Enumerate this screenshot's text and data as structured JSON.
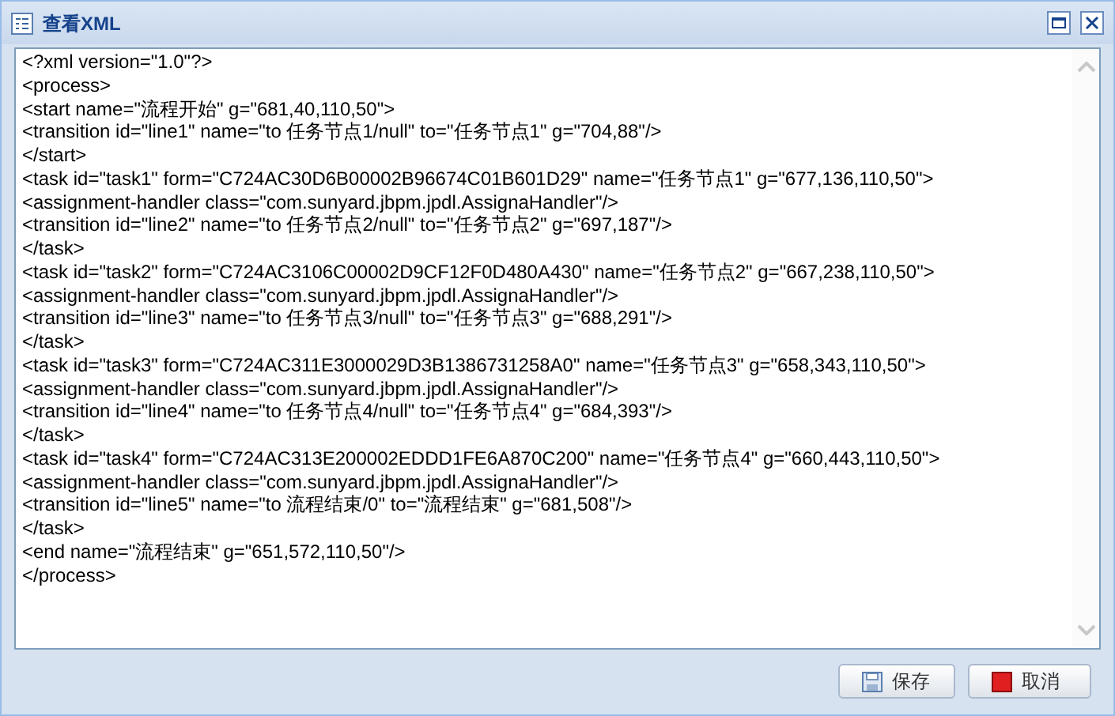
{
  "window": {
    "title": "查看XML"
  },
  "editor": {
    "lines": [
      "<?xml version=\"1.0\"?>",
      "<process>",
      "<start name=\"流程开始\" g=\"681,40,110,50\">",
      "<transition id=\"line1\" name=\"to 任务节点1/null\" to=\"任务节点1\" g=\"704,88\"/>",
      "</start>",
      "<task id=\"task1\" form=\"C724AC30D6B00002B96674C01B601D29\" name=\"任务节点1\" g=\"677,136,110,50\">",
      "<assignment-handler class=\"com.sunyard.jbpm.jpdl.AssignaHandler\"/>",
      "<transition id=\"line2\" name=\"to 任务节点2/null\" to=\"任务节点2\" g=\"697,187\"/>",
      "</task>",
      "<task id=\"task2\" form=\"C724AC3106C00002D9CF12F0D480A430\" name=\"任务节点2\" g=\"667,238,110,50\">",
      "<assignment-handler class=\"com.sunyard.jbpm.jpdl.AssignaHandler\"/>",
      "<transition id=\"line3\" name=\"to 任务节点3/null\" to=\"任务节点3\" g=\"688,291\"/>",
      "</task>",
      "<task id=\"task3\" form=\"C724AC311E3000029D3B1386731258A0\" name=\"任务节点3\" g=\"658,343,110,50\">",
      "<assignment-handler class=\"com.sunyard.jbpm.jpdl.AssignaHandler\"/>",
      "<transition id=\"line4\" name=\"to 任务节点4/null\" to=\"任务节点4\" g=\"684,393\"/>",
      "</task>",
      "<task id=\"task4\" form=\"C724AC313E200002EDDD1FE6A870C200\" name=\"任务节点4\" g=\"660,443,110,50\">",
      "<assignment-handler class=\"com.sunyard.jbpm.jpdl.AssignaHandler\"/>",
      "<transition id=\"line5\" name=\"to 流程结束/0\" to=\"流程结束\" g=\"681,508\"/>",
      "</task>",
      "<end name=\"流程结束\" g=\"651,572,110,50\"/>",
      "</process>"
    ]
  },
  "buttons": [
    {
      "kind": "save",
      "label": "保存"
    },
    {
      "kind": "cancel",
      "label": "取消"
    }
  ]
}
